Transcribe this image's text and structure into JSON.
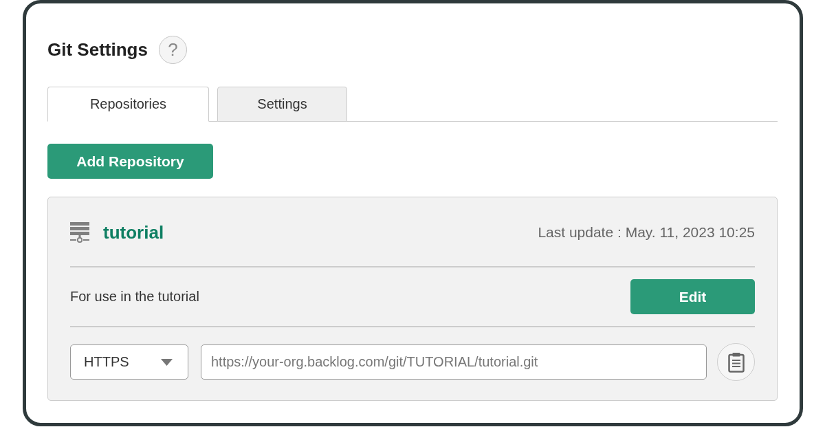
{
  "page": {
    "title": "Git Settings",
    "help_label": "?"
  },
  "tabs": [
    {
      "label": "Repositories",
      "selected": true
    },
    {
      "label": "Settings",
      "selected": false
    }
  ],
  "add_button": {
    "label": "Add Repository"
  },
  "repositories": [
    {
      "name": "tutorial",
      "last_update": "Last update : May. 11, 2023 10:25",
      "description": "For use in the tutorial",
      "edit_label": "Edit",
      "protocol": "HTTPS",
      "url": "https://your-org.backlog.com/git/TUTORIAL/tutorial.git"
    }
  ]
}
